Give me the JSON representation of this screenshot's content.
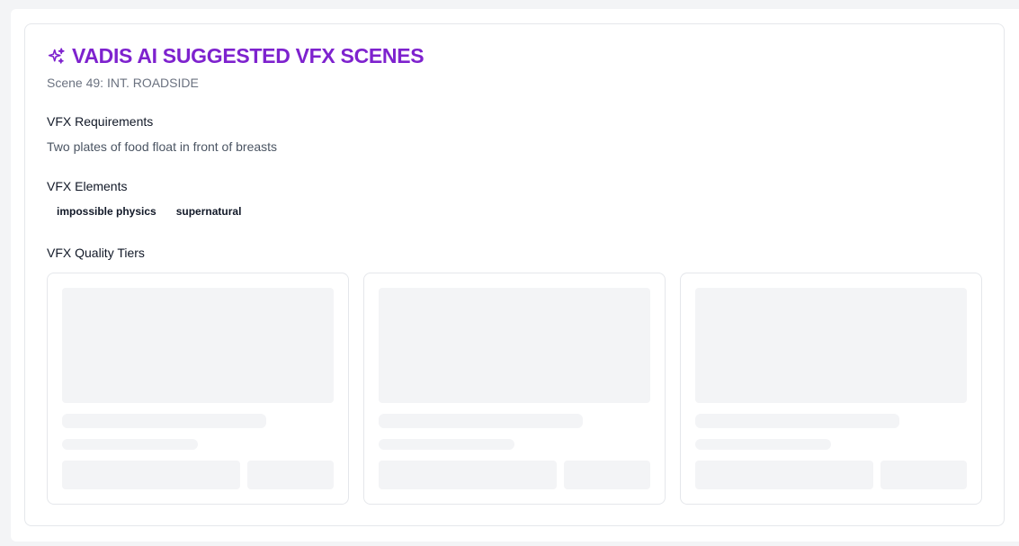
{
  "header": {
    "icon": "sparkles-icon",
    "title": "VADIS AI SUGGESTED VFX SCENES",
    "subtitle": "Scene 49: INT. ROADSIDE"
  },
  "requirements": {
    "heading": "VFX Requirements",
    "text": "Two plates of food float in front of breasts"
  },
  "elements": {
    "heading": "VFX Elements",
    "tags": [
      "impossible physics",
      "supernatural"
    ]
  },
  "tiers": {
    "heading": "VFX Quality Tiers",
    "loading": true,
    "count": 3
  },
  "colors": {
    "accent": "#7e22ce",
    "skeleton": "#f3f4f6",
    "border": "#e5e7eb"
  }
}
